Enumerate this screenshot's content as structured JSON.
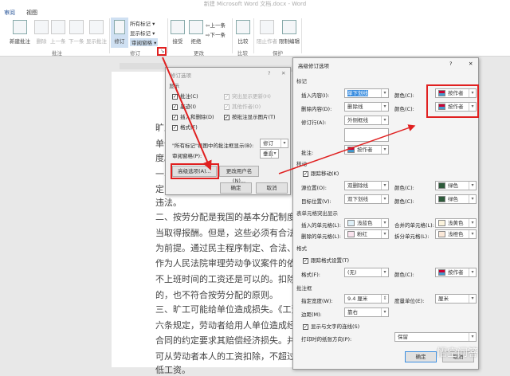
{
  "title": "新建 Microsoft Word 文档.docx - Word",
  "tabs": [
    "审阅",
    "视图"
  ],
  "ribbon": {
    "comment_group": {
      "label": "批注",
      "buttons": [
        "新建批注",
        "删除",
        "上一条",
        "下一条",
        "显示批注"
      ]
    },
    "track_group": {
      "label": "修订",
      "track": "修订",
      "markup": "所有标记",
      "show_markup": "显示标记",
      "pane": "审阅窗格"
    },
    "changes_group": {
      "label": "更改",
      "accept": "接受",
      "reject": "拒绝",
      "prev": "上一条",
      "next": "下一条"
    },
    "compare_group": {
      "label": "比较",
      "compare": "比较"
    },
    "protect_group": {
      "label": "保护",
      "block": "阻止作者",
      "restrict": "限制编辑"
    }
  },
  "doc_lines": [
    "旷工",
    "单位",
    "度。",
    "一、",
    "定",
    "违法。",
    "二、按劳分配是我国的基本分配制度，没有",
    "当取得报酬。但是，这些必须有合法有效的",
    "为前提。通过民主程序制定、合法、向劳动",
    "作为人民法院审理劳动争议案件的依据。广",
    "不上班时间的工资还是可以的。扣除当月工",
    "的，也不符合按劳分配的原则。",
    "三、旷工可能给单位造成损失。《工资支付",
    "六条规定，劳动者给用人单位造成经济损失",
    "合同的约定要求其赔偿经济损失。并且，",
    "可从劳动者本人的工资扣除，不超过 20%，",
    "低工资。"
  ],
  "track_dialog": {
    "title": "修订选项",
    "help": "?",
    "close": "✕",
    "section": "显示",
    "checks": [
      {
        "label": "批注(C)",
        "checked": true
      },
      {
        "label": "突出显示更新(H)",
        "checked": true,
        "disabled": true
      },
      {
        "label": "墨迹(I)",
        "checked": true
      },
      {
        "label": "其他作者(O)",
        "checked": true,
        "disabled": true
      },
      {
        "label": "插入和删除(D)",
        "checked": true
      },
      {
        "label": "按批注显示图片(T)",
        "checked": true
      },
      {
        "label": "格式(F)",
        "checked": true
      }
    ],
    "balloon_label": "\"所有标记\"视图中的批注框显示(B):",
    "balloon_value": "修订",
    "pane_label": "审阅窗格(P):",
    "pane_value": "垂直",
    "advanced": "高级选项(A)...",
    "username": "更改用户名(N)...",
    "ok": "确定",
    "cancel": "取消"
  },
  "adv_dialog": {
    "title": "高级修订选项",
    "help": "?",
    "close": "✕",
    "markup": "标记",
    "insert_label": "插入内容(I):",
    "insert_value": "单下划线",
    "delete_label": "删除内容(D):",
    "delete_value": "删除线",
    "lines_label": "修订行(A):",
    "lines_value": "外侧框线",
    "color_label": "颜色(C):",
    "color_value": "按作者",
    "comments_label": "批注:",
    "comments_value": "按作者",
    "moves": "移动",
    "track_moves": "跟踪移动(K)",
    "from_label": "源位置(O):",
    "from_value": "双删除线",
    "to_label": "目标位置(V):",
    "to_value": "双下划线",
    "move_color": "绿色",
    "table": "表单元格突出显示",
    "ins_cell_label": "插入的单元格(L):",
    "ins_cell_value": "浅蓝色",
    "merged_label": "合并的单元格(L):",
    "merged_value": "浅黄色",
    "del_cell_label": "删除的单元格(L):",
    "del_cell_value": "粉红",
    "split_label": "拆分单元格(L):",
    "split_value": "浅橙色",
    "formatting": "格式",
    "track_format": "跟踪格式设置(T)",
    "format_label": "格式(F):",
    "format_value": "(无)",
    "balloons": "批注框",
    "width_label": "指定宽度(W):",
    "width_value": "9.4 厘米",
    "measure_label": "度量单位(E):",
    "measure_value": "厘米",
    "margin_label": "边距(M):",
    "margin_value": "靠右",
    "lines_conn": "显示与文字的连线(S)",
    "print_label": "打印时的纸张方向(P):",
    "print_value": "保留",
    "ok": "确定",
    "cancel": "取消"
  },
  "watermark": "悟空问答",
  "colors": {
    "accent": "#2b579a",
    "highlight": "#e02020"
  }
}
